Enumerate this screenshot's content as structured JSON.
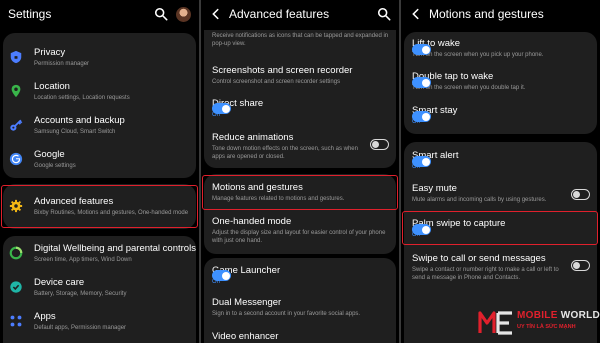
{
  "left_panel": {
    "title": "Settings",
    "items": [
      {
        "title": "Privacy",
        "subtitle": "Permission manager",
        "icon": "shield-icon",
        "icon_color": "#4c7dff"
      },
      {
        "title": "Location",
        "subtitle": "Location settings, Location requests",
        "icon": "location-pin-icon",
        "icon_color": "#39b54a"
      },
      {
        "title": "Accounts and backup",
        "subtitle": "Samsung Cloud, Smart Switch",
        "icon": "key-icon",
        "icon_color": "#4c7dff"
      },
      {
        "title": "Google",
        "subtitle": "Google settings",
        "icon": "google-icon",
        "icon_color": "#4285f4"
      },
      {
        "title": "Advanced features",
        "subtitle": "Bixby Routines, Motions and gestures, One-handed mode",
        "icon": "gear-plus-icon",
        "icon_color": "#f5b914"
      },
      {
        "title": "Digital Wellbeing and parental controls",
        "subtitle": "Screen time, App timers, Wind Down",
        "icon": "wellbeing-icon",
        "icon_color": "#39b54a"
      },
      {
        "title": "Device care",
        "subtitle": "Battery, Storage, Memory, Security",
        "icon": "device-care-icon",
        "icon_color": "#1fb5a6"
      },
      {
        "title": "Apps",
        "subtitle": "Default apps, Permission manager",
        "icon": "apps-grid-icon",
        "icon_color": "#4c7dff"
      }
    ]
  },
  "middle_panel": {
    "title": "Advanced features",
    "top_note": "Receive notifications as icons that can be tapped and expanded in pop-up view.",
    "items": [
      {
        "title": "Screenshots and screen recorder",
        "subtitle": "Control screenshot and screen recorder settings"
      },
      {
        "title": "Direct share",
        "status": "On",
        "toggle": "on"
      },
      {
        "title": "Reduce animations",
        "subtitle": "Tone down motion effects on the screen, such as when apps are opened or closed.",
        "toggle": "off"
      },
      {
        "title": "Motions and gestures",
        "subtitle": "Manage features related to motions and gestures."
      },
      {
        "title": "One-handed mode",
        "subtitle": "Adjust the display size and layout for easier control of your phone with just one hand."
      },
      {
        "title": "Game Launcher",
        "status": "On",
        "toggle": "on"
      },
      {
        "title": "Dual Messenger",
        "subtitle": "Sign in to a second account in your favorite social apps."
      },
      {
        "title": "Video enhancer"
      }
    ]
  },
  "right_panel": {
    "title": "Motions and gestures",
    "items": [
      {
        "title": "Lift to wake",
        "subtitle": "Turn on the screen when you pick up your phone.",
        "toggle": "on"
      },
      {
        "title": "Double tap to wake",
        "subtitle": "Turn on the screen when you double tap it.",
        "toggle": "on"
      },
      {
        "title": "Smart stay",
        "status": "On",
        "toggle": "on"
      },
      {
        "title": "Smart alert",
        "status": "On",
        "toggle": "on"
      },
      {
        "title": "Easy mute",
        "subtitle": "Mute alarms and incoming calls by using gestures.",
        "toggle": "off"
      },
      {
        "title": "Palm swipe to capture",
        "status": "On",
        "toggle": "on"
      },
      {
        "title": "Swipe to call or send messages",
        "subtitle": "Swipe a contact or number right to make a call or left to send a message in Phone and Contacts.",
        "toggle": "off"
      }
    ]
  },
  "watermark": {
    "name_main": "MOBILE",
    "name_accent": "WORLD",
    "tagline": "UY TÍN LÀ SỨC MẠNH"
  },
  "colors": {
    "accent_blue": "#3e91ff",
    "highlight_red": "#e0202c",
    "card_bg": "#1f1f1f"
  }
}
